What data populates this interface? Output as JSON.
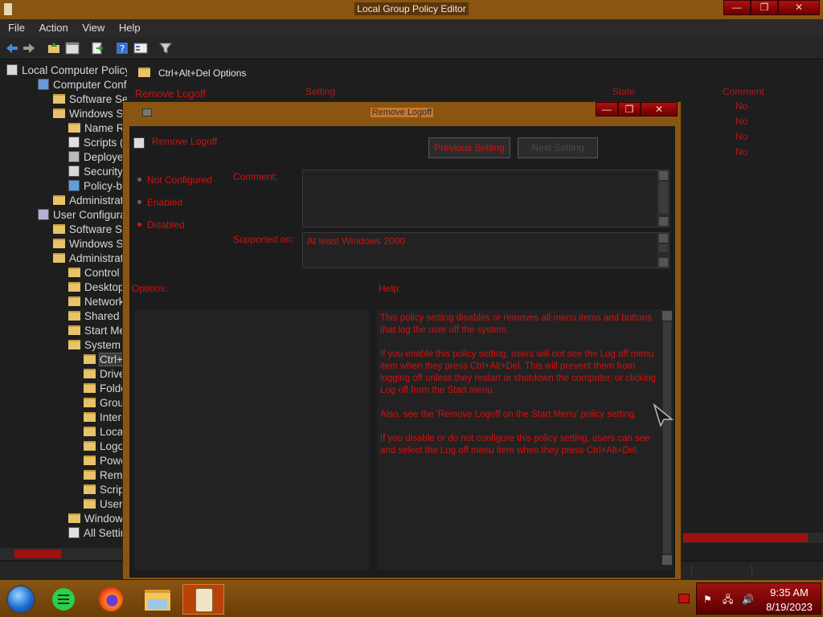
{
  "window": {
    "title": "Local Group Policy Editor",
    "buttons": [
      "—",
      "❒",
      "✕"
    ]
  },
  "menu": [
    "File",
    "Action",
    "View",
    "Help"
  ],
  "toolbar": {
    "icons": [
      "back-arrow-icon",
      "forward-arrow-icon",
      "up-folder-icon",
      "show-hide-tree-icon",
      "export-list-icon",
      "help-icon",
      "properties-icon",
      "filter-icon"
    ]
  },
  "tree": {
    "items": [
      {
        "label": "Local Computer Policy",
        "level": 0,
        "icon": "policy-icon"
      },
      {
        "label": "Computer Configura",
        "level": 1,
        "icon": "computer-icon"
      },
      {
        "label": "Software Settin",
        "level": 2,
        "icon": "folder"
      },
      {
        "label": "Windows Setti",
        "level": 2,
        "icon": "folder"
      },
      {
        "label": "Name Reso",
        "level": 3,
        "icon": "folder"
      },
      {
        "label": "Scripts (Sta",
        "level": 3,
        "icon": "script-icon"
      },
      {
        "label": "Deployed P",
        "level": 3,
        "icon": "printer-icon"
      },
      {
        "label": "Security Se",
        "level": 3,
        "icon": "security-icon"
      },
      {
        "label": "Policy-base",
        "level": 3,
        "icon": "chart-icon"
      },
      {
        "label": "Administrative",
        "level": 2,
        "icon": "folder"
      },
      {
        "label": "User Configuration",
        "level": 1,
        "icon": "user-icon"
      },
      {
        "label": "Software Settin",
        "level": 2,
        "icon": "folder"
      },
      {
        "label": "Windows Setti",
        "level": 2,
        "icon": "folder"
      },
      {
        "label": "Administrative",
        "level": 2,
        "icon": "folder"
      },
      {
        "label": "Control Par",
        "level": 3,
        "icon": "folder"
      },
      {
        "label": "Desktop",
        "level": 3,
        "icon": "folder"
      },
      {
        "label": "Network",
        "level": 3,
        "icon": "folder"
      },
      {
        "label": "Shared Fold",
        "level": 3,
        "icon": "folder"
      },
      {
        "label": "Start Menu",
        "level": 3,
        "icon": "folder"
      },
      {
        "label": "System",
        "level": 3,
        "icon": "folder"
      },
      {
        "label": "Ctrl+Alt+",
        "level": 4,
        "icon": "folder",
        "selected": true
      },
      {
        "label": "Driver In",
        "level": 4,
        "icon": "folder"
      },
      {
        "label": "Folder R",
        "level": 4,
        "icon": "folder"
      },
      {
        "label": "Group P",
        "level": 4,
        "icon": "folder"
      },
      {
        "label": "Internet",
        "level": 4,
        "icon": "folder"
      },
      {
        "label": "Locale S",
        "level": 4,
        "icon": "folder"
      },
      {
        "label": "Logon",
        "level": 4,
        "icon": "folder"
      },
      {
        "label": "Power M",
        "level": 4,
        "icon": "folder"
      },
      {
        "label": "Remova",
        "level": 4,
        "icon": "folder"
      },
      {
        "label": "Scripts",
        "level": 4,
        "icon": "folder"
      },
      {
        "label": "User Pro",
        "level": 4,
        "icon": "folder"
      },
      {
        "label": "Windows C",
        "level": 3,
        "icon": "folder"
      },
      {
        "label": "All Settings",
        "level": 3,
        "icon": "settings-icon"
      }
    ]
  },
  "right_pane": {
    "header": "Ctrl+Alt+Del Options",
    "selected_title": "Remove Logoff",
    "columns": [
      "Setting",
      "State",
      "Comment"
    ],
    "state_values": [
      "No",
      "No",
      "No",
      "No"
    ]
  },
  "dialog": {
    "title": "Remove Logoff",
    "setting_name": "Remove Logoff",
    "prev_button": "Previous Setting",
    "next_button": "Next Setting",
    "radios": [
      {
        "label": "Not Configured",
        "checked": false
      },
      {
        "label": "Enabled",
        "checked": false
      },
      {
        "label": "Disabled",
        "checked": true
      }
    ],
    "comment_label": "Comment:",
    "comment_value": "",
    "supported_label": "Supported on:",
    "supported_value": "At least Windows 2000",
    "options_label": "Options:",
    "help_label": "Help:",
    "help_paragraphs": [
      "This policy setting disables or removes all menu items and buttons that log the user off the system.",
      "If you enable this policy setting, users will not see the Log off menu item when they press Ctrl+Alt+Del. This will prevent them from logging off unless they restart or shutdown the computer, or clicking Log off from the Start menu.",
      "Also, see the 'Remove Logoff on the Start Menu' policy setting.",
      "If you disable or do not configure this policy setting, users can see and select the Log off menu item when they press Ctrl+Alt+Del."
    ]
  },
  "taskbar": {
    "apps": [
      "start-orb-icon",
      "notes-app-icon",
      "firefox-icon",
      "file-manager-icon",
      "group-policy-editor-icon"
    ],
    "tray_icons": [
      "flag-icon",
      "network-icon",
      "volume-icon"
    ],
    "time": "9:35 AM",
    "date": "8/19/2023"
  },
  "colors": {
    "accent": "#8a5512",
    "text_red": "#d41010",
    "background": "#1c1c1c"
  }
}
